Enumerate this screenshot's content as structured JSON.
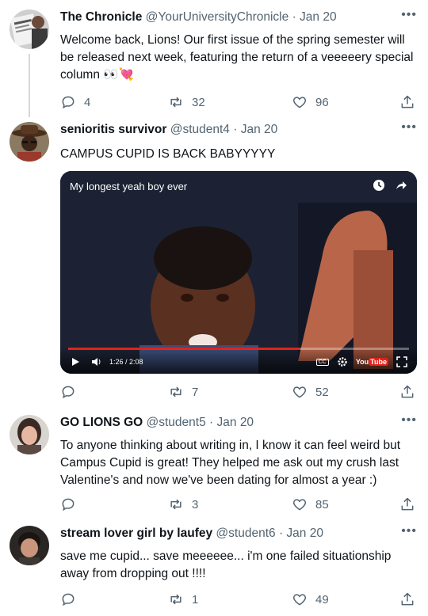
{
  "tweets": [
    {
      "name": "The Chronicle",
      "handle": "@YourUniversityChronicle",
      "separator": "·",
      "date": "Jan 20",
      "text": "Welcome back, Lions! Our first issue of the spring semester will be released next week, featuring the return of a veeeeery special column",
      "emoji": "👀💘",
      "replies": "4",
      "retweets": "32",
      "likes": "96",
      "more": "•••"
    },
    {
      "name": "senioritis survivor",
      "handle": "@student4",
      "separator": "·",
      "date": "Jan 20",
      "text": "CAMPUS CUPID IS BACK BABYYYYY",
      "replies": "",
      "retweets": "7",
      "likes": "52",
      "more": "•••",
      "video": {
        "title": "My longest yeah boy ever",
        "time": "1:26 / 2:08",
        "progress": 0.68,
        "cc_label": "CC",
        "youtube_label": "You",
        "youtube_tube": "Tube"
      }
    },
    {
      "name": "GO LIONS GO",
      "handle": "@student5",
      "separator": "·",
      "date": "Jan 20",
      "text": "To anyone thinking about writing in, I know it can feel weird but Campus Cupid is great! They helped me ask out my crush last Valentine's and now we've been dating for almost a year :)",
      "replies": "",
      "retweets": "3",
      "likes": "85",
      "more": "•••"
    },
    {
      "name": "stream lover girl by laufey",
      "handle": "@student6",
      "separator": "·",
      "date": "Jan 20",
      "text": "save me cupid... save meeeeee... i'm one failed situationship away from dropping out !!!!",
      "replies": "",
      "retweets": "1",
      "likes": "49",
      "more": "•••"
    }
  ],
  "colors": {
    "text": "#0f1419",
    "secondary": "#536471",
    "thread_line": "#cfd9de",
    "youtube_red": "#e62117"
  }
}
